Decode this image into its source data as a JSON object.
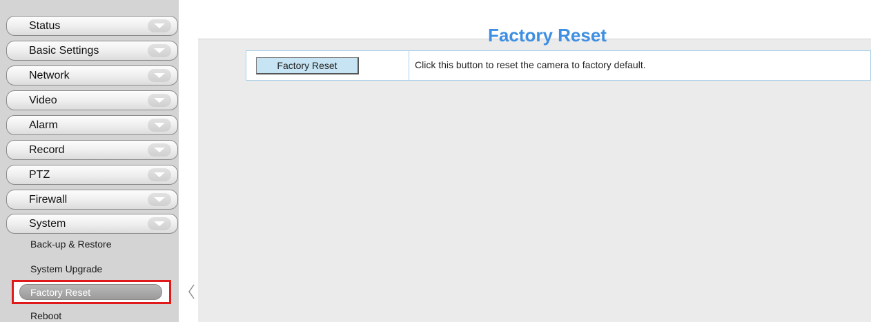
{
  "sidebar": {
    "menu": [
      {
        "label": "Status"
      },
      {
        "label": "Basic Settings"
      },
      {
        "label": "Network"
      },
      {
        "label": "Video"
      },
      {
        "label": "Alarm"
      },
      {
        "label": "Record"
      },
      {
        "label": "PTZ"
      },
      {
        "label": "Firewall"
      },
      {
        "label": "System"
      }
    ],
    "submenu": [
      {
        "label": "Back-up & Restore"
      },
      {
        "label": "System Upgrade"
      },
      {
        "label": "Factory Reset",
        "active": true
      },
      {
        "label": "Reboot"
      }
    ]
  },
  "main": {
    "title": "Factory Reset",
    "row": {
      "button_label": "Factory Reset",
      "description": "Click this button to reset the camera to factory default."
    }
  },
  "colors": {
    "title": "#3e8fe3",
    "highlight_border": "#e01a1a",
    "button_bg": "#c6e4f3",
    "row_border": "#a9d0ea",
    "sidebar_bg": "#d4d4d4",
    "main_bg": "#ebebeb"
  },
  "icons": {
    "menu_arrow": "chevron-down-icon",
    "collapse": "chevron-left-icon"
  }
}
